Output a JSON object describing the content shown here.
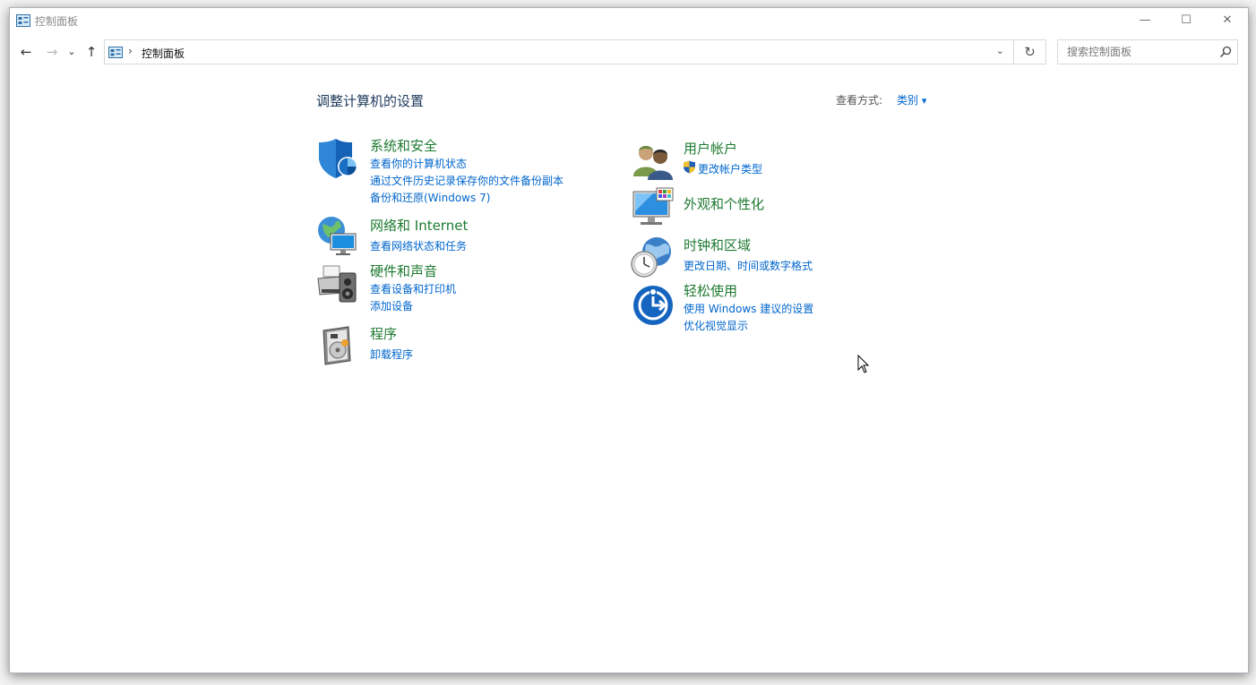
{
  "window": {
    "title": "控制面板",
    "minimize_glyph": "—",
    "maximize_glyph": "☐",
    "close_glyph": "✕"
  },
  "nav": {
    "back_glyph": "←",
    "forward_glyph": "→",
    "recent_glyph": "⌄",
    "up_glyph": "↑",
    "breadcrumb_sep": "›",
    "address": "控制面板",
    "dropdown_glyph": "⌄",
    "refresh_glyph": "↻",
    "search_placeholder": "搜索控制面板"
  },
  "main": {
    "title": "调整计算机的设置",
    "view_by_label": "查看方式:",
    "view_by_value": "类别",
    "view_by_arrow": "▾"
  },
  "categories": [
    {
      "title": "系统和安全",
      "icon": "shield-icon",
      "links": [
        "查看你的计算机状态",
        "通过文件历史记录保存你的文件备份副本",
        "备份和还原(Windows 7)"
      ]
    },
    {
      "title": "网络和 Internet",
      "icon": "network-globe-icon",
      "links": [
        "查看网络状态和任务"
      ]
    },
    {
      "title": "硬件和声音",
      "icon": "printer-speaker-icon",
      "links": [
        "查看设备和打印机",
        "添加设备"
      ]
    },
    {
      "title": "程序",
      "icon": "programs-disc-icon",
      "links": [
        "卸载程序"
      ]
    },
    {
      "title": "用户帐户",
      "icon": "users-icon",
      "links": [
        "更改帐户类型"
      ]
    },
    {
      "title": "外观和个性化",
      "icon": "monitor-color-icon",
      "links": []
    },
    {
      "title": "时钟和区域",
      "icon": "clock-globe-icon",
      "links": [
        "更改日期、时间或数字格式"
      ]
    },
    {
      "title": "轻松使用",
      "icon": "ease-of-access-icon",
      "links": [
        "使用 Windows 建议的设置",
        "优化视觉显示"
      ]
    }
  ],
  "colors": {
    "category_title": "#1d7a30",
    "link": "#0066cc",
    "heading": "#1e395b"
  }
}
